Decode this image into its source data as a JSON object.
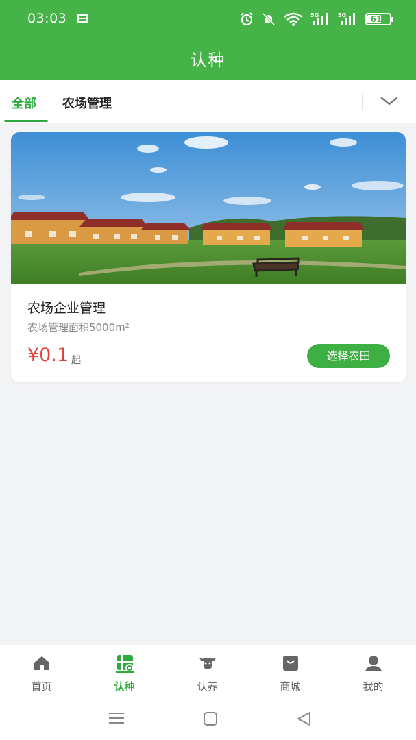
{
  "status_bar": {
    "time": "03:03",
    "battery": "61"
  },
  "header": {
    "title": "认种"
  },
  "tabs": {
    "items": [
      {
        "label": "全部"
      },
      {
        "label": "农场管理"
      }
    ],
    "active_index": 0
  },
  "card": {
    "image_icon": "farm-photo",
    "name": "农场企业管理",
    "subtitle": "农场管理面积5000m²",
    "price": "¥0.1",
    "price_unit": "起",
    "button_label": "选择农田"
  },
  "tabbar": {
    "items": [
      {
        "label": "首页",
        "icon": "home-icon"
      },
      {
        "label": "认种",
        "icon": "plant-icon"
      },
      {
        "label": "认养",
        "icon": "cow-icon"
      },
      {
        "label": "商城",
        "icon": "shop-bag-icon"
      },
      {
        "label": "我的",
        "icon": "user-icon"
      }
    ],
    "active_index": 1
  },
  "colors": {
    "brand_green": "#45b348",
    "active_green": "#2eaa3f",
    "price_red": "#e3413f"
  }
}
